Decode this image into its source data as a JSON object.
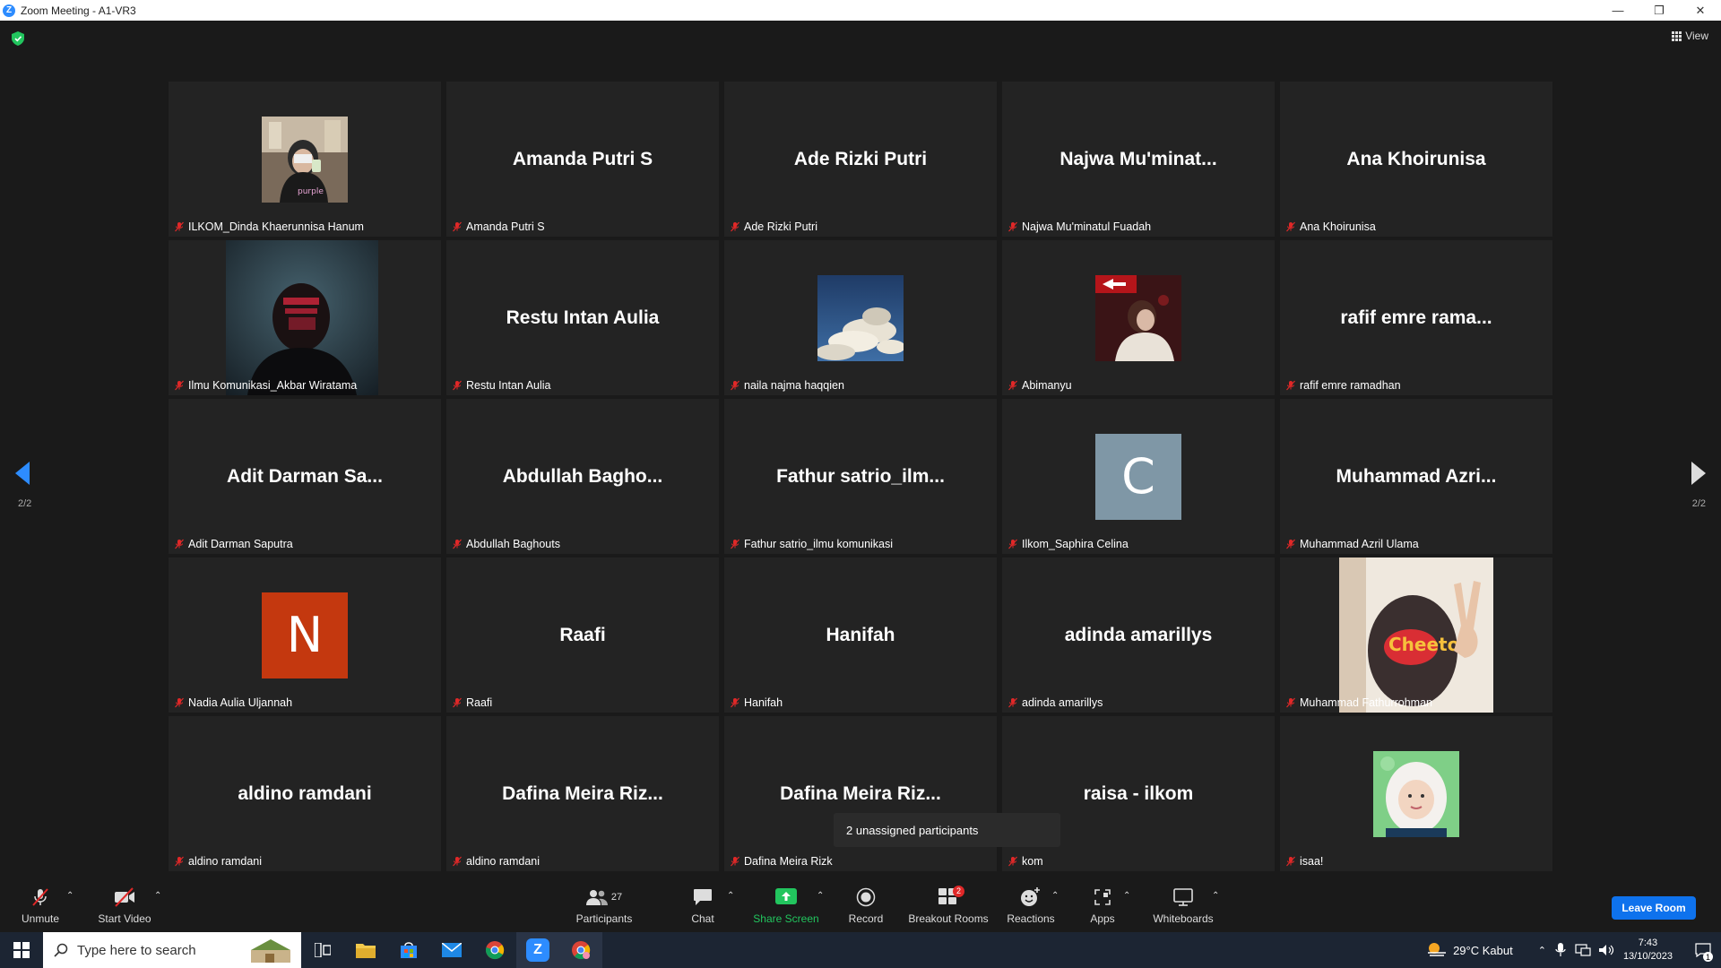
{
  "window": {
    "title": "Zoom Meeting - A1-VR3"
  },
  "meeting": {
    "view_label": "View",
    "page_indicator": "2/2",
    "tiles": [
      {
        "display": "",
        "name": "ILKOM_Dinda Khaerunnisa Hanum",
        "avatar": "photo-selfie"
      },
      {
        "display": "Amanda Putri S",
        "name": "Amanda Putri S"
      },
      {
        "display": "Ade Rizki Putri",
        "name": "Ade Rizki Putri"
      },
      {
        "display": "Najwa  Mu'minat...",
        "name": "Najwa Mu'minatul Fuadah"
      },
      {
        "display": "Ana Khoirunisa",
        "name": "Ana Khoirunisa"
      },
      {
        "display": "",
        "name": "Ilmu Komunikasi_Akbar Wiratama",
        "avatar": "video-dark"
      },
      {
        "display": "Restu Intan Aulia",
        "name": "Restu Intan Aulia"
      },
      {
        "display": "",
        "name": "naila najma haqqien",
        "avatar": "photo-clouds"
      },
      {
        "display": "",
        "name": "Abimanyu",
        "avatar": "photo-night"
      },
      {
        "display": "rafif emre rama...",
        "name": "rafif emre ramadhan"
      },
      {
        "display": "Adit Darman Sa...",
        "name": "Adit Darman Saputra"
      },
      {
        "display": "Abdullah  Bagho...",
        "name": "Abdullah Baghouts"
      },
      {
        "display": "Fathur  satrio_ilm...",
        "name": "Fathur satrio_ilmu komunikasi"
      },
      {
        "display": "",
        "name": "Ilkom_Saphira Celina",
        "avatar": "letter",
        "letter": "C",
        "color": "#7f97a6"
      },
      {
        "display": "Muhammad  Azri...",
        "name": "Muhammad Azril Ulama"
      },
      {
        "display": "",
        "name": "Nadia Aulia Uljannah",
        "avatar": "letter",
        "letter": "N",
        "color": "#c4380f"
      },
      {
        "display": "Raafi",
        "name": "Raafi"
      },
      {
        "display": "Hanifah",
        "name": "Hanifah"
      },
      {
        "display": "adinda amarillys",
        "name": "adinda amarillys"
      },
      {
        "display": "",
        "name": "Muhammad Fathurrohman",
        "avatar": "video-peace"
      },
      {
        "display": "aldino ramdani",
        "name": "aldino ramdani"
      },
      {
        "display": "Dafina  Meira  Riz...",
        "name": "aldino ramdani"
      },
      {
        "display": "Dafina  Meira  Riz...",
        "name": "Dafina Meira Rizk"
      },
      {
        "display": "raisa - ilkom",
        "name": "kom"
      },
      {
        "display": "",
        "name": "isaa!",
        "avatar": "photo-girl"
      }
    ],
    "tooltip": "2 unassigned participants"
  },
  "toolbar": {
    "unmute": "Unmute",
    "start_video": "Start Video",
    "participants": "Participants",
    "participants_count": "27",
    "chat": "Chat",
    "share_screen": "Share Screen",
    "record": "Record",
    "breakout_rooms": "Breakout Rooms",
    "breakout_badge": "2",
    "reactions": "Reactions",
    "apps": "Apps",
    "whiteboards": "Whiteboards",
    "leave": "Leave Room"
  },
  "taskbar": {
    "search_placeholder": "Type here to search",
    "weather": "29°C  Kabut",
    "time": "7:43",
    "date": "13/10/2023",
    "notifications": "1"
  },
  "colors": {
    "accent": "#0e72ed",
    "share_green": "#22c55e",
    "mute_red": "#e02828"
  }
}
